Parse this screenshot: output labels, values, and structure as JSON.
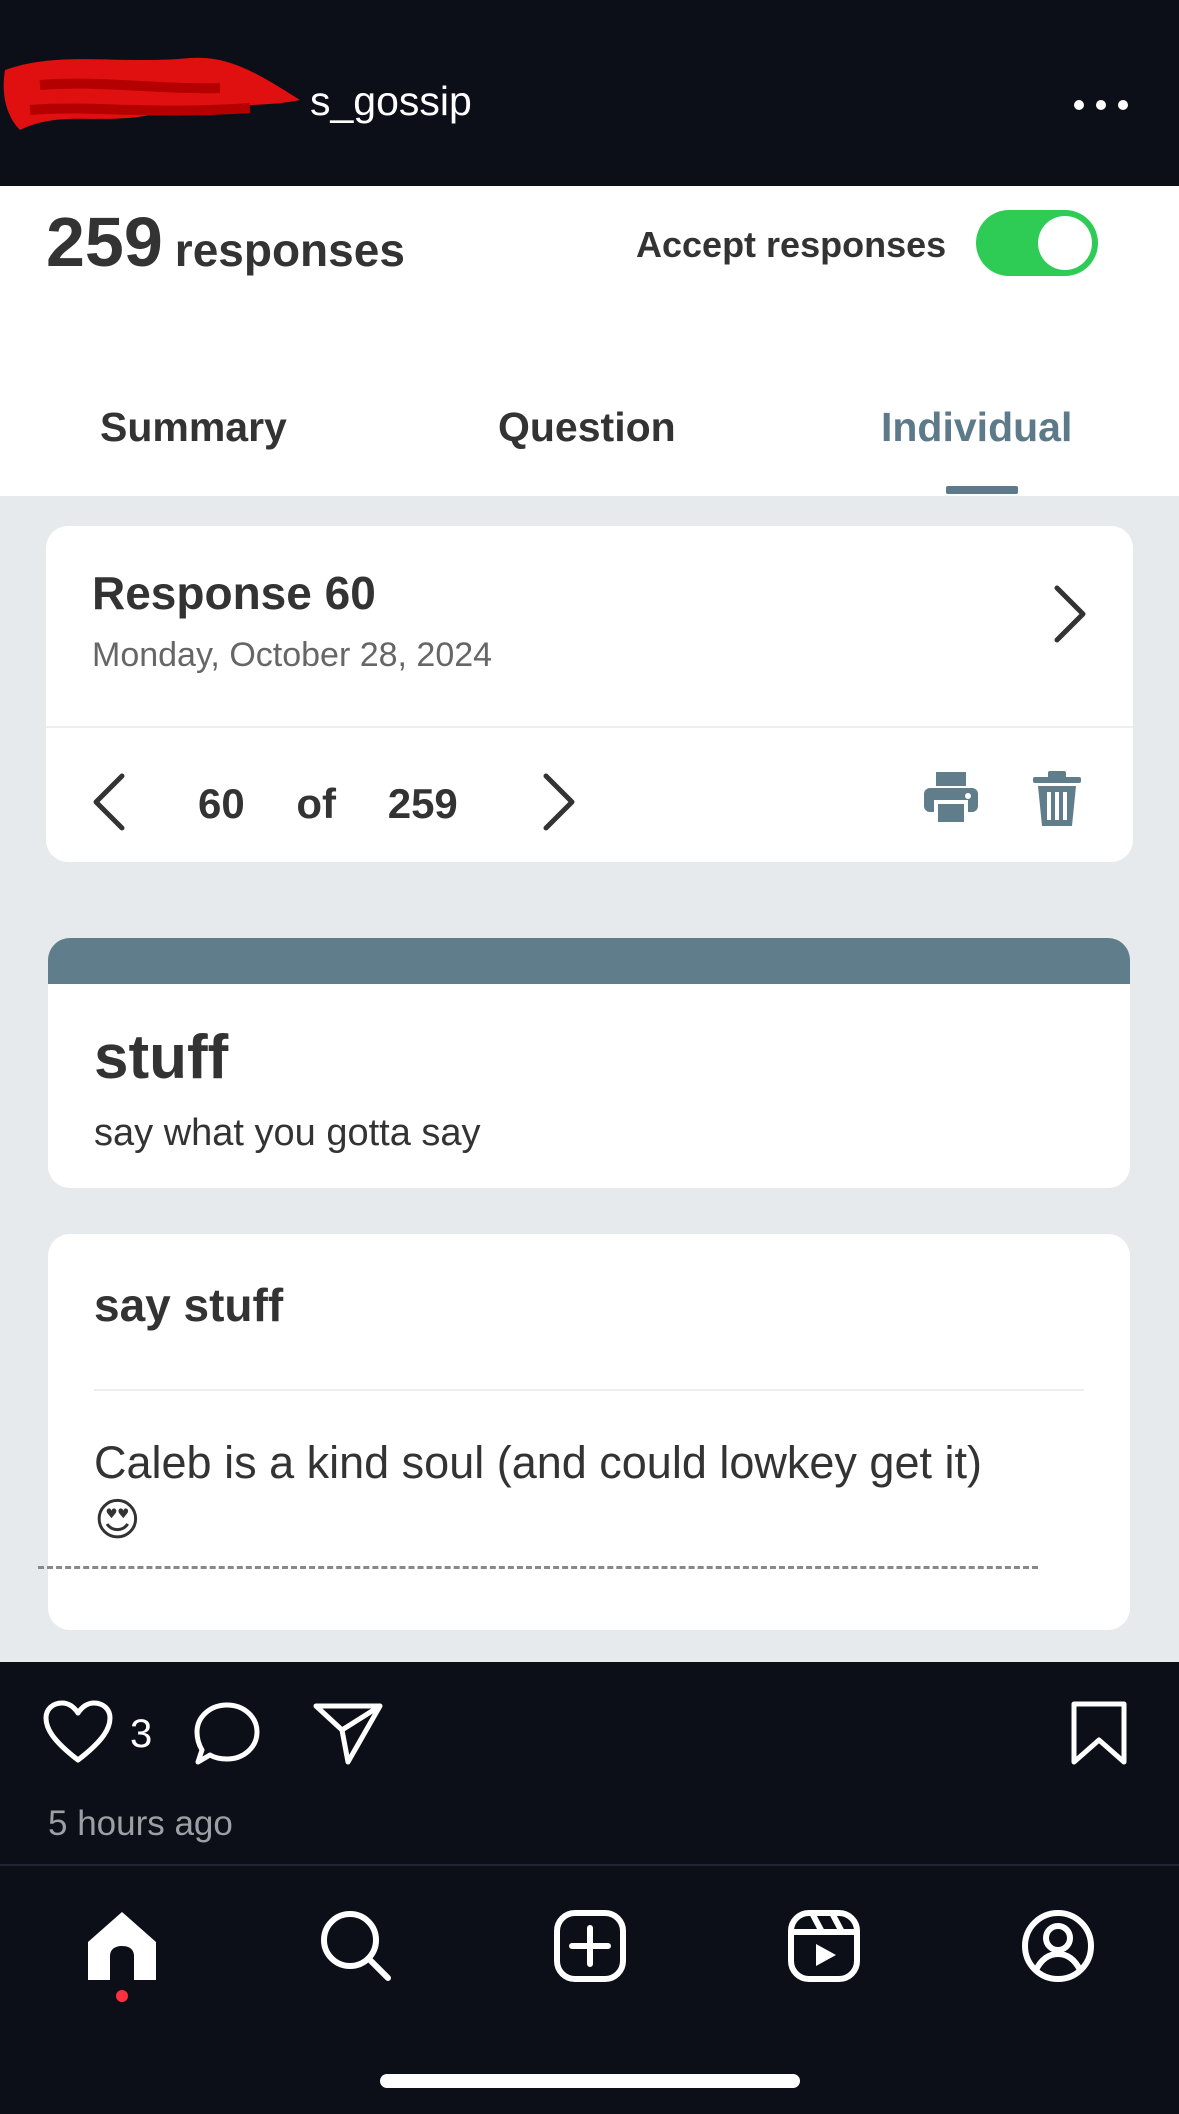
{
  "topbar": {
    "account_suffix": "s_gossip",
    "more_icon": "more-horizontal-icon"
  },
  "form_header": {
    "response_count": "259",
    "responses_word": "responses",
    "accept_label": "Accept responses",
    "accept_enabled": true,
    "toggle_color": "#2ecc54"
  },
  "tabs": [
    {
      "label": "Summary",
      "active": false
    },
    {
      "label": "Question",
      "active": false
    },
    {
      "label": "Individual",
      "active": true
    }
  ],
  "response": {
    "title": "Response 60",
    "date": "Monday, October 28, 2024",
    "current": "60",
    "of": "of",
    "total": "259"
  },
  "form": {
    "title": "stuff",
    "description": "say what you gotta say",
    "accent_color": "#607d8b"
  },
  "question": {
    "title": "say stuff",
    "answer": "Caleb is a kind soul (and could lowkey get it) 😍"
  },
  "post": {
    "like_count": "3",
    "time_ago": "5 hours ago"
  },
  "colors": {
    "background": "#0c0f17",
    "tab_active": "#5d7a8a",
    "notification_dot": "#ff3040"
  }
}
